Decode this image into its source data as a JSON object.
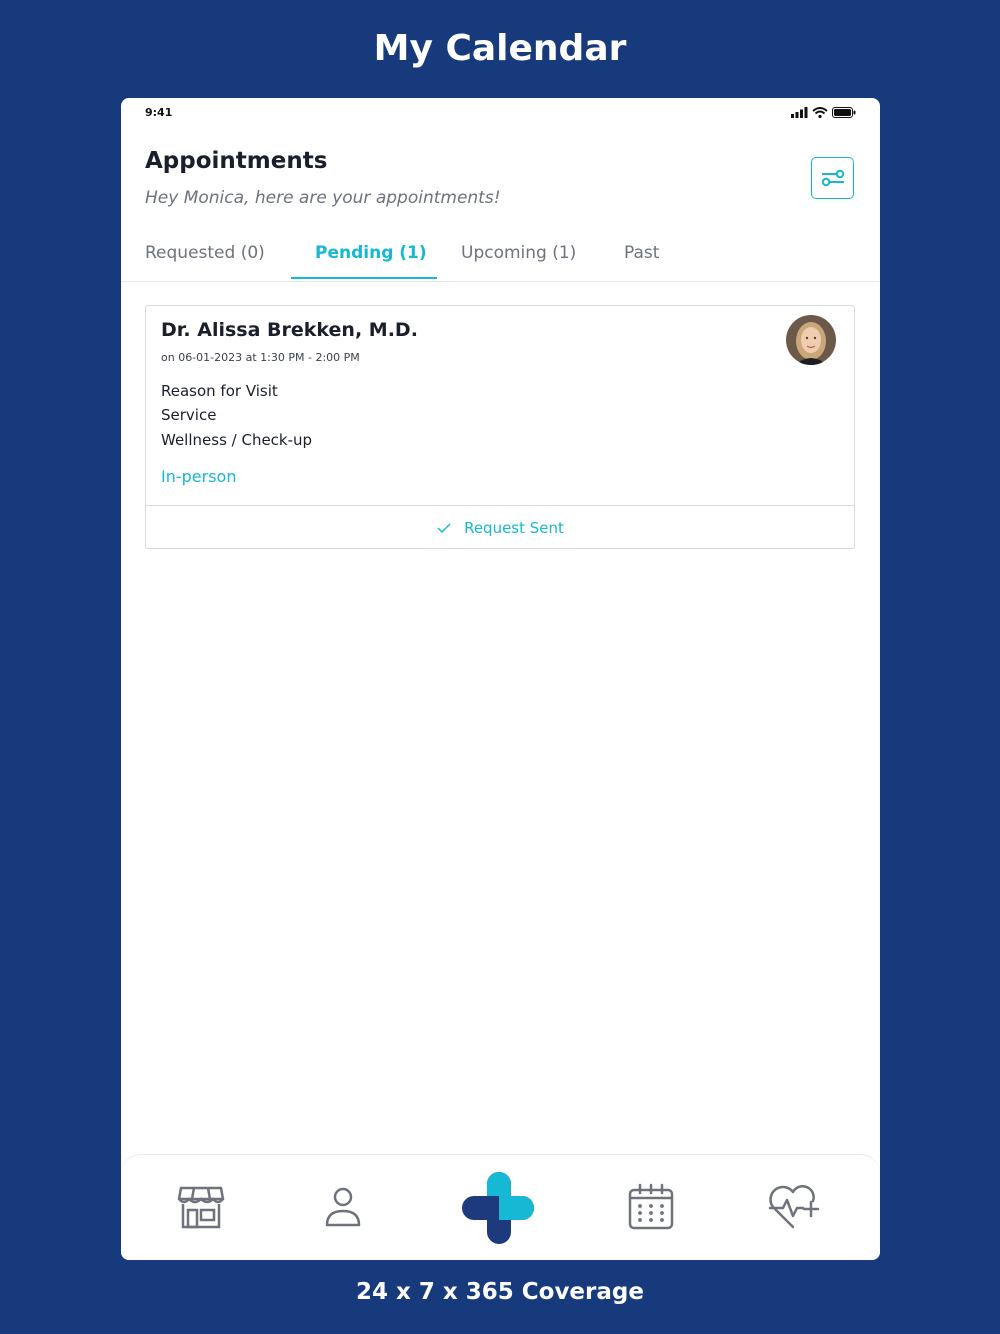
{
  "promo": {
    "title": "My Calendar",
    "footer": "24 x 7 x 365 Coverage"
  },
  "status_bar": {
    "time": "9:41",
    "icons": [
      "signal-icon",
      "wifi-icon",
      "battery-icon"
    ]
  },
  "header": {
    "title": "Appointments",
    "subtitle": "Hey Monica, here are your appointments!",
    "filter_icon": "filter-sliders-icon"
  },
  "tabs": [
    {
      "label": "Requested (0)",
      "active": false
    },
    {
      "label": "Pending (1)",
      "active": true
    },
    {
      "label": "Upcoming (1)",
      "active": false
    },
    {
      "label": "Past",
      "active": false
    }
  ],
  "appointment": {
    "doctor_name": "Dr. Alissa Brekken, M.D.",
    "time": "on 06-01-2023 at 1:30 PM - 2:00 PM",
    "reason_label": "Reason for Visit",
    "service_label": "Service",
    "service_value": "Wellness / Check-up",
    "visit_type": "In-person",
    "status": "Request Sent",
    "status_icon": "check-icon"
  },
  "bottom_nav": [
    {
      "icon": "store-icon"
    },
    {
      "icon": "profile-icon"
    },
    {
      "icon": "health-plus-logo-icon"
    },
    {
      "icon": "calendar-icon"
    },
    {
      "icon": "heart-pulse-plus-icon"
    }
  ],
  "colors": {
    "background": "#163a7c",
    "accent": "#16b8d4",
    "logo_dark": "#1d3b7c",
    "text_primary": "#1b1f2b",
    "text_secondary": "#6d727c"
  }
}
